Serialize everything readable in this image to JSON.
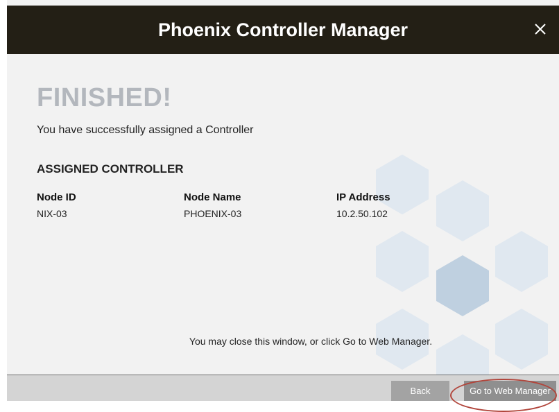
{
  "window": {
    "title": "Phoenix Controller Manager",
    "close_icon": "close-icon"
  },
  "main": {
    "heading": "FINISHED!",
    "message": "You have successfully assigned a Controller",
    "section_title": "ASSIGNED CONTROLLER",
    "columns": [
      {
        "label": "Node ID",
        "value": "NIX-03"
      },
      {
        "label": "Node Name",
        "value": "PHOENIX-03"
      },
      {
        "label": "IP Address",
        "value": "10.2.50.102"
      }
    ],
    "footnote": "You may close this window, or click Go to Web Manager."
  },
  "footer": {
    "back_label": "Back",
    "web_manager_label": "Go to Web Manager"
  },
  "colors": {
    "titlebar": "#231f15",
    "heading": "#b3b7bd",
    "highlight_ring": "#b1453b"
  }
}
